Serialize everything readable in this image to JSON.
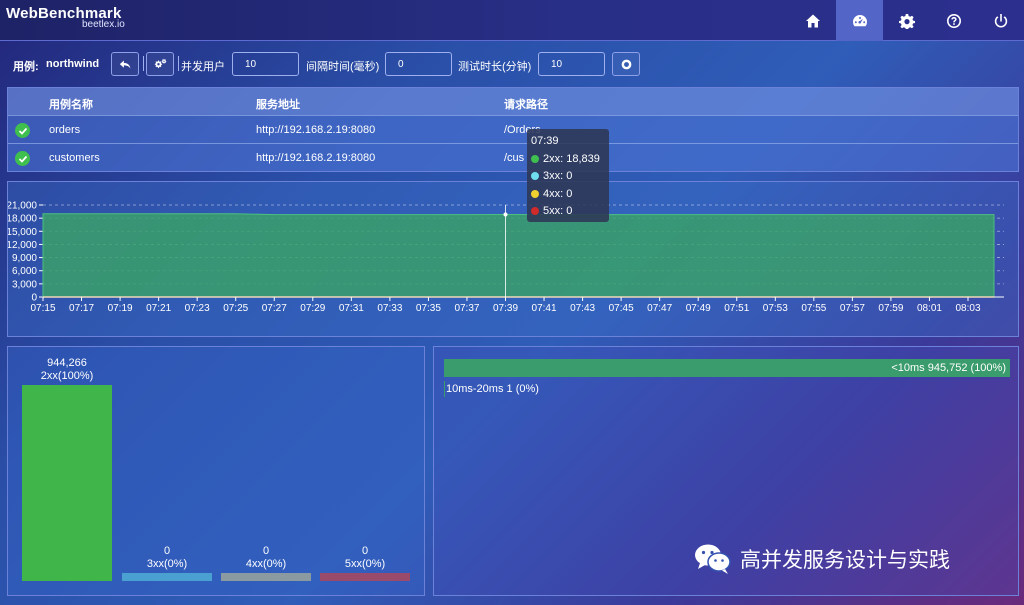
{
  "app": {
    "title": "WebBenchmark",
    "subtitle": "beetlex.io"
  },
  "nav": {
    "items": [
      {
        "icon": "home-icon",
        "active": false
      },
      {
        "icon": "dashboard-icon",
        "active": true
      },
      {
        "icon": "gear-icon",
        "active": false
      },
      {
        "icon": "help-icon",
        "active": false
      },
      {
        "icon": "power-icon",
        "active": false
      }
    ]
  },
  "toolbar": {
    "case_label": "用例:",
    "case_name": "northwind",
    "users_label": "并发用户",
    "users_value": "10",
    "interval_label": "间隔时间(毫秒)",
    "interval_value": "0",
    "duration_label": "测试时长(分钟)",
    "duration_value": "10"
  },
  "table": {
    "headers": [
      "用例名称",
      "服务地址",
      "请求路径"
    ],
    "rows": [
      {
        "name": "orders",
        "address": "http://192.168.2.19:8080",
        "path": "/Orders",
        "status": "ok"
      },
      {
        "name": "customers",
        "address": "http://192.168.2.19:8080",
        "path": "/cus",
        "status": "ok"
      }
    ]
  },
  "chart_data": [
    {
      "type": "area",
      "x": [
        "07:15",
        "07:17",
        "07:19",
        "07:21",
        "07:23",
        "07:25",
        "07:27",
        "07:29",
        "07:31",
        "07:33",
        "07:35",
        "07:37",
        "07:39",
        "07:41",
        "07:43",
        "07:45",
        "07:47",
        "07:49",
        "07:51",
        "07:53",
        "07:55",
        "07:57",
        "07:59",
        "08:01",
        "08:03"
      ],
      "ylim": [
        0,
        21000
      ],
      "yticks": [
        "21,000",
        "18,000",
        "15,000",
        "12,000",
        "9,000",
        "6,000",
        "3,000",
        "0"
      ],
      "ytick_values": [
        21000,
        18000,
        15000,
        12000,
        9000,
        6000,
        3000,
        0
      ],
      "grid": true,
      "series": [
        {
          "name": "2xx",
          "color": "#3aa06a",
          "values": [
            19000,
            19000,
            19000,
            19000,
            19000,
            19000,
            18800,
            18800,
            18800,
            18800,
            18800,
            18800,
            18839,
            18800,
            18800,
            18800,
            18800,
            18800,
            18800,
            18800,
            18800,
            18800,
            18800,
            18800,
            18800
          ]
        },
        {
          "name": "3xx",
          "color": "#6fdcf0",
          "values": [
            0,
            0,
            0,
            0,
            0,
            0,
            0,
            0,
            0,
            0,
            0,
            0,
            0,
            0,
            0,
            0,
            0,
            0,
            0,
            0,
            0,
            0,
            0,
            0,
            0
          ]
        },
        {
          "name": "4xx",
          "color": "#f0d030",
          "values": [
            0,
            0,
            0,
            0,
            0,
            0,
            0,
            0,
            0,
            0,
            0,
            0,
            0,
            0,
            0,
            0,
            0,
            0,
            0,
            0,
            0,
            0,
            0,
            0,
            0
          ]
        },
        {
          "name": "5xx",
          "color": "#d02a2a",
          "values": [
            0,
            0,
            0,
            0,
            0,
            0,
            0,
            0,
            0,
            0,
            0,
            0,
            0,
            0,
            0,
            0,
            0,
            0,
            0,
            0,
            0,
            0,
            0,
            0,
            0
          ]
        }
      ],
      "tooltip": {
        "time": "07:39",
        "rows": [
          {
            "label": "2xx: 18,839",
            "color": "#3fbf4e"
          },
          {
            "label": "3xx: 0",
            "color": "#6fdcf0"
          },
          {
            "label": "4xx: 0",
            "color": "#f0d030"
          },
          {
            "label": "5xx: 0",
            "color": "#d02a2a"
          }
        ]
      }
    },
    {
      "type": "bar",
      "categories": [
        "2xx",
        "3xx",
        "4xx",
        "5xx"
      ],
      "values": [
        944266,
        0,
        0,
        0
      ],
      "value_labels": [
        "944,266",
        "0",
        "0",
        "0"
      ],
      "category_labels": [
        "2xx(100%)",
        "3xx(0%)",
        "4xx(0%)",
        "5xx(0%)"
      ],
      "colors": [
        "#3fb54a",
        "#4aa0d0",
        "#8a9aa0",
        "#9a4a6a"
      ]
    },
    {
      "type": "bar",
      "orientation": "horizontal",
      "categories": [
        "<10ms",
        "10ms-20ms"
      ],
      "values": [
        945752,
        1
      ],
      "labels": [
        "<10ms 945,752 (100%)",
        "10ms-20ms 1 (0%)"
      ],
      "color": "#3a9c6c"
    }
  ],
  "watermark": {
    "text": "高并发服务设计与实践"
  }
}
